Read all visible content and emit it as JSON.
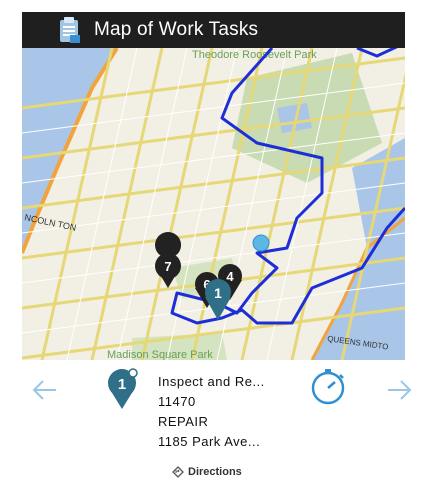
{
  "header": {
    "title": "Map of Work Tasks",
    "icon": "clipboard-icon"
  },
  "map": {
    "labels": {
      "park_top": "Theodore Roosevelt Park",
      "lincoln": "NCOLN TON",
      "park_bottom": "Madison Square Park",
      "queens": "QUEENS MIDTO"
    },
    "markers": [
      {
        "label": "7",
        "color": "#222222"
      },
      {
        "label": "6",
        "color": "#222222"
      },
      {
        "label": "4",
        "color": "#222222"
      },
      {
        "label": "1",
        "color": "#2f6f87"
      }
    ],
    "route_color": "#1e2ed6",
    "location_dot_color": "#5bb8e6"
  },
  "task": {
    "pin_label": "1",
    "title": "Inspect and Re...",
    "id": "11470",
    "type": "REPAIR",
    "address": "1185 Park Ave..."
  },
  "actions": {
    "directions": "Directions"
  },
  "colors": {
    "accent": "#2f8fd0",
    "pin": "#2f6f87"
  }
}
